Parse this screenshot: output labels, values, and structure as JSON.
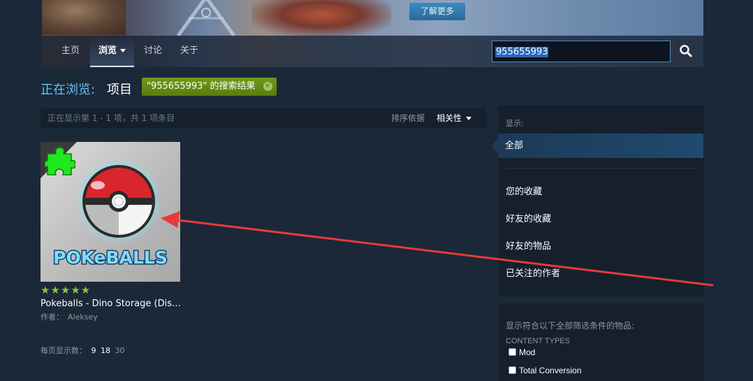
{
  "header": {
    "learn_more": "了解更多",
    "nav": [
      {
        "label": "主页"
      },
      {
        "label": "浏览"
      },
      {
        "label": "讨论"
      },
      {
        "label": "关于"
      }
    ],
    "search_value": "955655993"
  },
  "browse": {
    "label": "正在浏览:",
    "value": "项目",
    "search_tag": "\"955655993\" 的搜索结果"
  },
  "results": {
    "count_text": "正在显示第 1 - 1 项，共 1 项条目",
    "sort_label": "排序依据",
    "sort_value": "相关性"
  },
  "item": {
    "rating_stars": 5,
    "stars": "★★★★★",
    "title": "Pokeballs - Dino Storage (Dis…",
    "author_label": "作者：",
    "author": "Aleksey",
    "logo_text": "POKeBALLS"
  },
  "per_page": {
    "label": "每页显示数：",
    "options": [
      "9",
      "18",
      "30"
    ]
  },
  "sidebar": {
    "header": "显示:",
    "active": "全部",
    "links": [
      "您的收藏",
      "好友的收藏",
      "好友的物品",
      "已关注的作者"
    ]
  },
  "filters": {
    "heading": "显示符合以下全部筛选条件的物品:",
    "content_types_label": "CONTENT TYPES",
    "options": [
      "Mod",
      "Total Conversion"
    ]
  },
  "colors": {
    "background": "#1b2838",
    "accent_blue": "#66c0f4",
    "tag_green": "#5c7e10",
    "star_green": "#8bc53f",
    "annotation_red": "#e83a3a"
  }
}
